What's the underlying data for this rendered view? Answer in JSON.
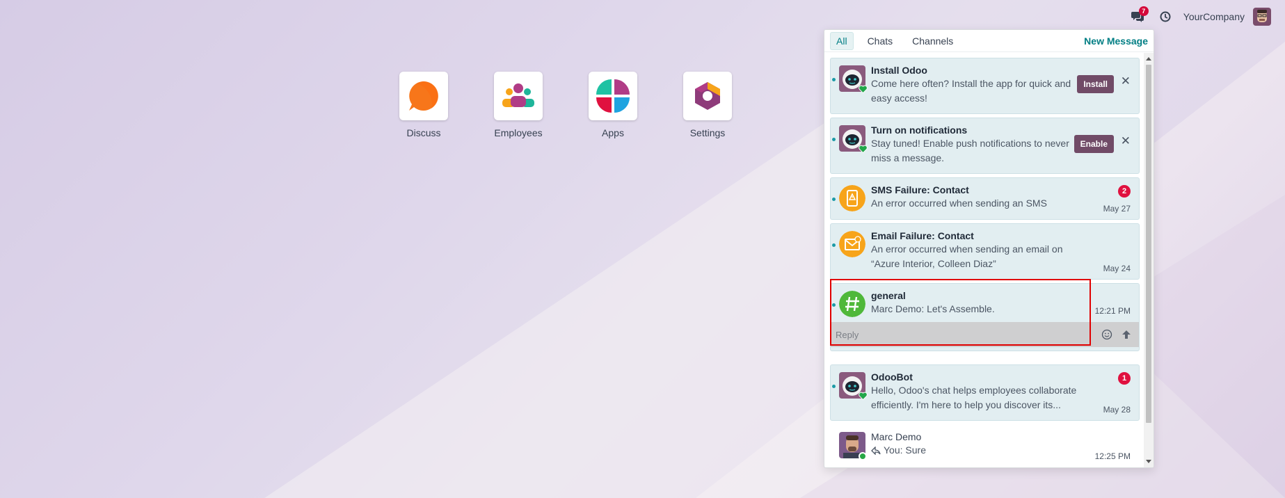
{
  "navbar": {
    "chat_badge": "7",
    "company": "YourCompany"
  },
  "apps": [
    {
      "label": "Discuss",
      "icon": "discuss-icon"
    },
    {
      "label": "Employees",
      "icon": "employees-icon"
    },
    {
      "label": "Apps",
      "icon": "apps-icon"
    },
    {
      "label": "Settings",
      "icon": "settings-icon"
    }
  ],
  "messaging": {
    "tabs": [
      "All",
      "Chats",
      "Channels"
    ],
    "active_tab": "All",
    "new_message": "New Message",
    "items": [
      {
        "title": "Install Odoo",
        "text": "Come here often? Install the app for quick and easy access!",
        "action": "Install"
      },
      {
        "title": "Turn on notifications",
        "text": "Stay tuned! Enable push notifications to never miss a message.",
        "action": "Enable"
      },
      {
        "title": "SMS Failure: Contact",
        "text": "An error occurred when sending an SMS",
        "time": "May 27",
        "count": "2"
      },
      {
        "title": "Email Failure: Contact",
        "text": "An error occurred when sending an email on “Azure Interior, Colleen Diaz”",
        "time": "May 24"
      },
      {
        "title": "general",
        "text": "Marc Demo: Let's Assemble.",
        "time": "12:21 PM",
        "reply_placeholder": "Reply"
      },
      {
        "title": "OdooBot",
        "text": "Hello, Odoo's chat helps employees collaborate efficiently. I'm here to help you discover its...",
        "time": "May 28",
        "count": "1"
      },
      {
        "title": "Marc Demo",
        "text": "You: Sure",
        "time": "12:25 PM"
      }
    ]
  },
  "colors": {
    "accent": "#017e84",
    "primary_button": "#714b67",
    "badge": "#e0113f",
    "unread_card": "#e2eef1"
  }
}
